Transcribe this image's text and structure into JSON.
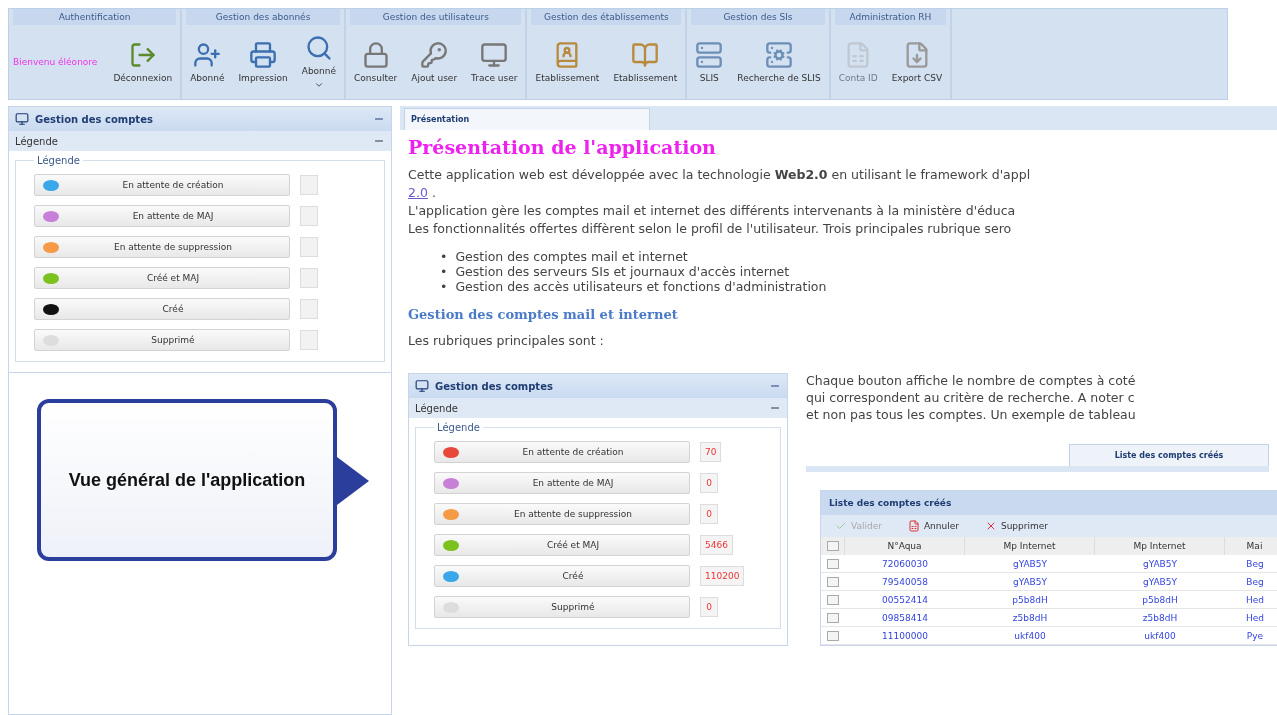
{
  "toolbar": {
    "groups": [
      {
        "title": "Authentification",
        "welcome": "Bienvenu éléonore",
        "buttons": [
          {
            "label": "Déconnexion",
            "disabled": false
          }
        ]
      },
      {
        "title": "Gestion des abonnés",
        "buttons": [
          {
            "label": "Abonné",
            "disabled": false
          },
          {
            "label": "Impression",
            "disabled": false
          },
          {
            "label": "Abonné",
            "disabled": false,
            "dropdown": true
          }
        ]
      },
      {
        "title": "Gestion des utilisateurs",
        "buttons": [
          {
            "label": "Consulter",
            "disabled": false
          },
          {
            "label": "Ajout user",
            "disabled": false
          },
          {
            "label": "Trace user",
            "disabled": false
          }
        ]
      },
      {
        "title": "Gestion des établissements",
        "buttons": [
          {
            "label": "Etablissement",
            "disabled": false
          },
          {
            "label": "Etablissement",
            "disabled": false
          }
        ]
      },
      {
        "title": "Gestion des SIs",
        "buttons": [
          {
            "label": "SLIS",
            "disabled": false
          },
          {
            "label": "Recherche de SLIS",
            "disabled": false
          }
        ]
      },
      {
        "title": "Administration RH",
        "buttons": [
          {
            "label": "Conta ID",
            "disabled": true
          },
          {
            "label": "Export CSV",
            "disabled": false
          }
        ]
      }
    ]
  },
  "sidebar": {
    "title": "Gestion des comptes",
    "section": "Légende",
    "legend_title": "Légende",
    "items": [
      {
        "label": "En attente de création",
        "color": "#3aa8e8"
      },
      {
        "label": "En attente de MAJ",
        "color": "#c77fd8"
      },
      {
        "label": "En attente de suppression",
        "color": "#f59a45"
      },
      {
        "label": "Créé et MAJ",
        "color": "#7cc21e"
      },
      {
        "label": "Créé",
        "color": "#111111"
      },
      {
        "label": "Supprimé",
        "color": "#dddddd"
      }
    ]
  },
  "callout": "Vue général de l'application",
  "tab": {
    "label": "Présentation",
    "selected": true
  },
  "content": {
    "heading": "Présentation de l'application",
    "intro": "Cette application web est développée avec la technologie **Web2.0** en utilisant le framework d'appl",
    "intro_link": "2.0",
    "intro_end": ".",
    "lines": [
      "L'application gère les comptes mail et internet des différents intervenants à la ministère d'éduca",
      "Les fonctionnalités offertes diffèrent selon le profil de l'utilisateur. Trois principales rubrique sero"
    ],
    "bullets": [
      {
        "marker": "•",
        "text": "Gestion des comptes mail et internet"
      },
      {
        "marker": "•",
        "text": "Gestion des serveurs SIs et journaux d'accès internet"
      },
      {
        "marker": "•",
        "text": "Gestion des accès utilisateurs et fonctions d'administration"
      }
    ],
    "subheading": "Gestion des comptes mail et internet",
    "rubriques": "Les rubriques principales sont :",
    "side_lines": [
      "Chaque bouton affiche le nombre de comptes à coté",
      "qui correspondent au critère de recherche. A noter c",
      "et non pas tous les comptes. Un exemple de tableau"
    ]
  },
  "example_panel": {
    "title": "Gestion des comptes",
    "section": "Légende",
    "legend_title": "Légende",
    "items": [
      {
        "label": "En attente de création",
        "color": "#e8473a",
        "count": "70"
      },
      {
        "label": "En attente de MAJ",
        "color": "#c77fd8",
        "count": "0"
      },
      {
        "label": "En attente de suppression",
        "color": "#f59a45",
        "count": "0"
      },
      {
        "label": "Créé et MAJ",
        "color": "#7cc21e",
        "count": "5466"
      },
      {
        "label": "Créé",
        "color": "#3aa8e8",
        "count": "110200"
      },
      {
        "label": "Supprimé",
        "color": "#dddddd",
        "count": "0"
      }
    ]
  },
  "example_grid": {
    "tab": "Liste des comptes créés",
    "title": "Liste des comptes créés",
    "actions": [
      {
        "label": "Valider",
        "disabled": true
      },
      {
        "label": "Annuler",
        "disabled": false
      },
      {
        "label": "Supprimer",
        "disabled": false
      }
    ],
    "select_all_checked": false,
    "columns": [
      "N°Aqua",
      "Mp Internet",
      "Mp Internet",
      "Mai"
    ],
    "rows": [
      {
        "checked": false,
        "cells": [
          "72060030",
          "gYAB5Y",
          "gYAB5Y",
          "Beg"
        ]
      },
      {
        "checked": false,
        "cells": [
          "79540058",
          "gYAB5Y",
          "gYAB5Y",
          "Beg"
        ]
      },
      {
        "checked": false,
        "cells": [
          "00552414",
          "p5b8dH",
          "p5b8dH",
          "Hed"
        ]
      },
      {
        "checked": false,
        "cells": [
          "09858414",
          "z5b8dH",
          "z5b8dH",
          "Hed"
        ]
      },
      {
        "checked": false,
        "cells": [
          "11100000",
          "ukf400",
          "ukf400",
          "Pye"
        ]
      }
    ]
  }
}
